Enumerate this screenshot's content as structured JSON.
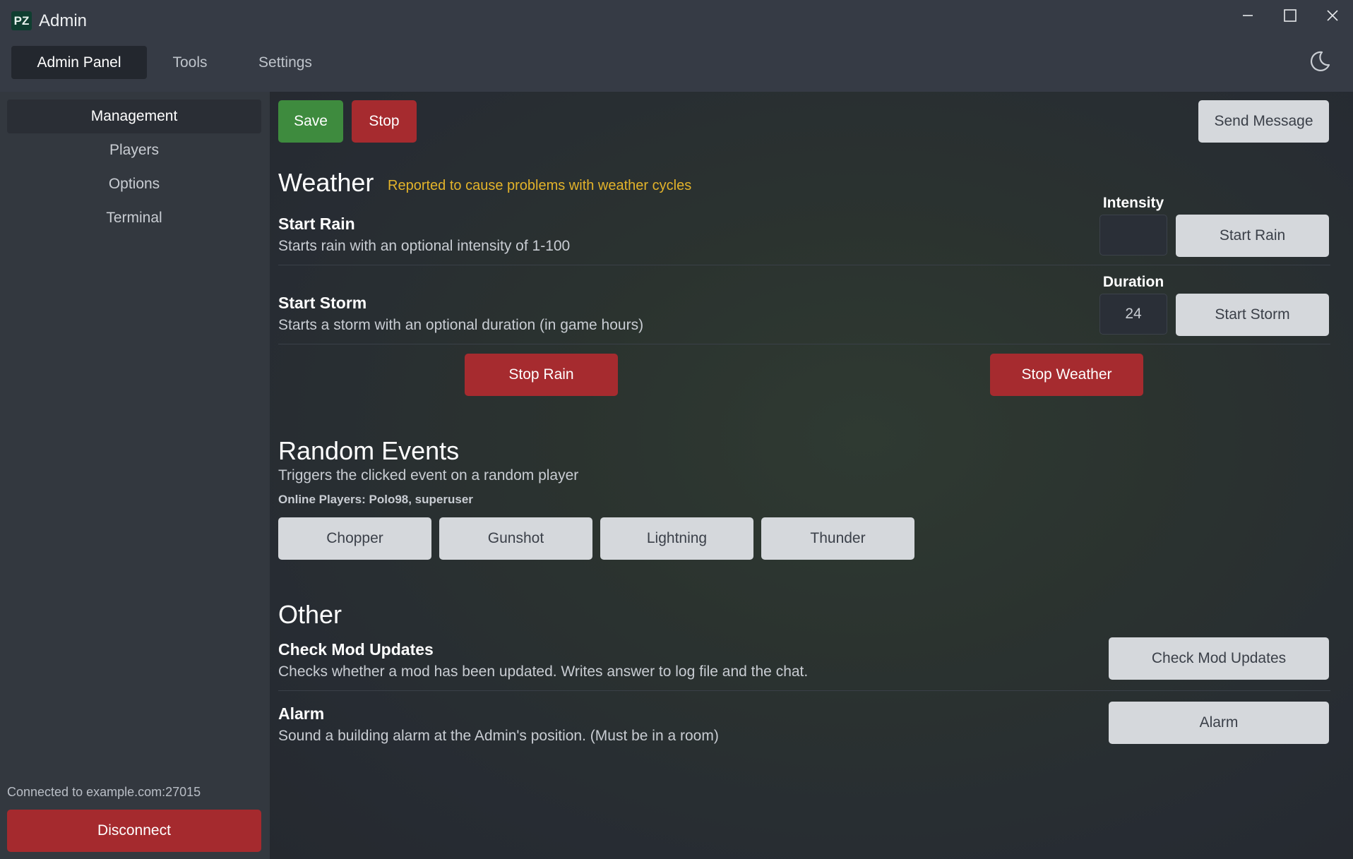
{
  "window": {
    "logo": "PZ",
    "title": "Admin",
    "controls": [
      "minimize-icon",
      "maximize-icon",
      "close-icon"
    ]
  },
  "menu": {
    "tabs": [
      {
        "label": "Admin Panel",
        "active": true
      },
      {
        "label": "Tools",
        "active": false
      },
      {
        "label": "Settings",
        "active": false
      }
    ],
    "theme_icon": "moon-icon"
  },
  "sidebar": {
    "items": [
      {
        "label": "Management",
        "active": true
      },
      {
        "label": "Players",
        "active": false
      },
      {
        "label": "Options",
        "active": false
      },
      {
        "label": "Terminal",
        "active": false
      }
    ],
    "connection": "Connected to example.com:27015",
    "disconnect_label": "Disconnect"
  },
  "toolbar": {
    "save_label": "Save",
    "stop_label": "Stop",
    "send_message_label": "Send Message"
  },
  "weather": {
    "title": "Weather",
    "warning": "Reported to cause problems with weather cycles",
    "rain": {
      "title": "Start Rain",
      "description": "Starts rain with an optional intensity of 1-100",
      "field_label": "Intensity",
      "field_value": "",
      "button_label": "Start Rain"
    },
    "storm": {
      "title": "Start Storm",
      "description": "Starts a storm with an optional duration (in game hours)",
      "field_label": "Duration",
      "field_value": "24",
      "button_label": "Start Storm"
    },
    "stop_rain_label": "Stop Rain",
    "stop_weather_label": "Stop Weather"
  },
  "random_events": {
    "title": "Random Events",
    "description": "Triggers the clicked event on a random player",
    "online_players": "Online Players: Polo98, superuser",
    "events": [
      "Chopper",
      "Gunshot",
      "Lightning",
      "Thunder"
    ]
  },
  "other": {
    "title": "Other",
    "mod_updates": {
      "title": "Check Mod Updates",
      "description": "Checks whether a mod has been updated. Writes answer to log file and the chat.",
      "button_label": "Check Mod Updates"
    },
    "alarm": {
      "title": "Alarm",
      "description": "Sound a building alarm at the Admin's position. (Must be in a room)",
      "button_label": "Alarm"
    }
  },
  "colors": {
    "green": "#3e8b3e",
    "red": "#a62b2f",
    "warning": "#e3b32a",
    "light_button": "#d5d8dc"
  }
}
